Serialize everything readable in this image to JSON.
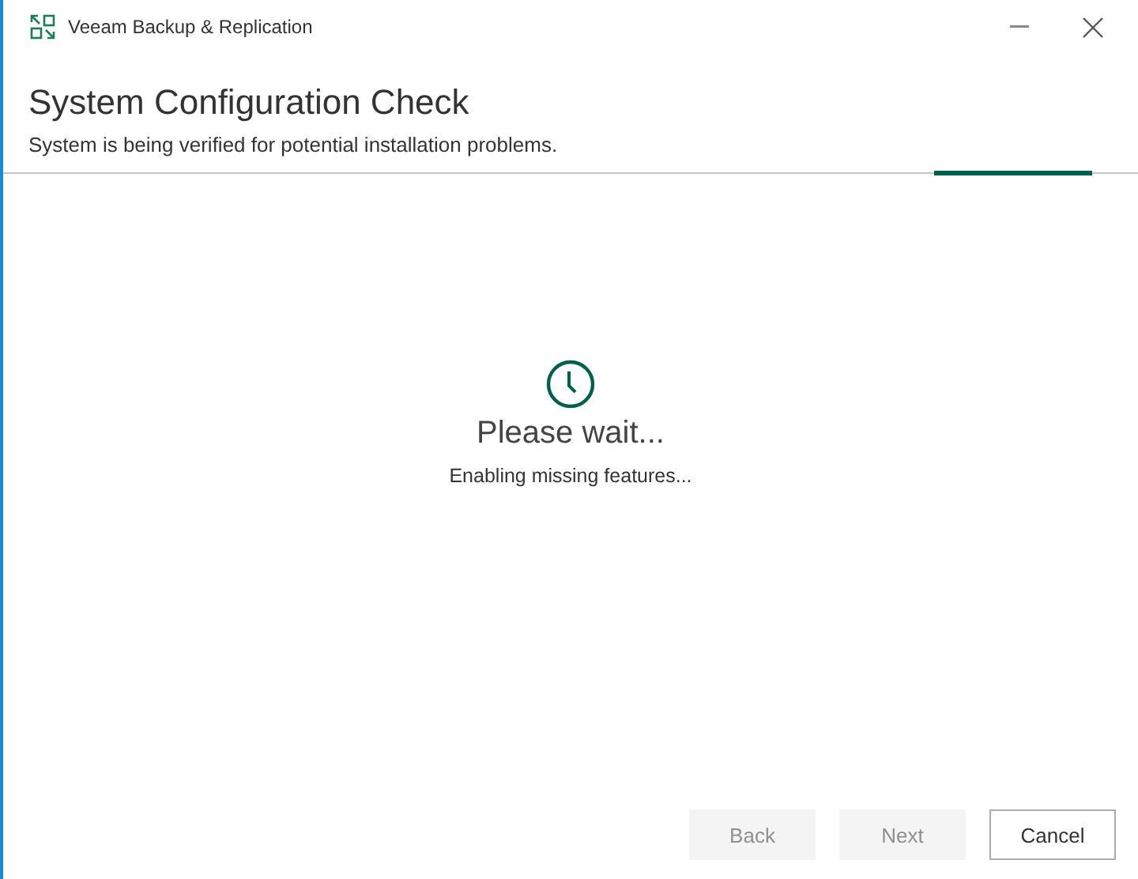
{
  "window": {
    "title": "Veeam Backup & Replication"
  },
  "header": {
    "title": "System Configuration Check",
    "subtitle": "System is being verified for potential installation problems."
  },
  "status": {
    "title": "Please wait...",
    "message": "Enabling missing features..."
  },
  "buttons": [
    {
      "label": "Back",
      "disabled": true
    },
    {
      "label": "Next",
      "disabled": true
    },
    {
      "label": "Cancel",
      "disabled": false
    }
  ]
}
